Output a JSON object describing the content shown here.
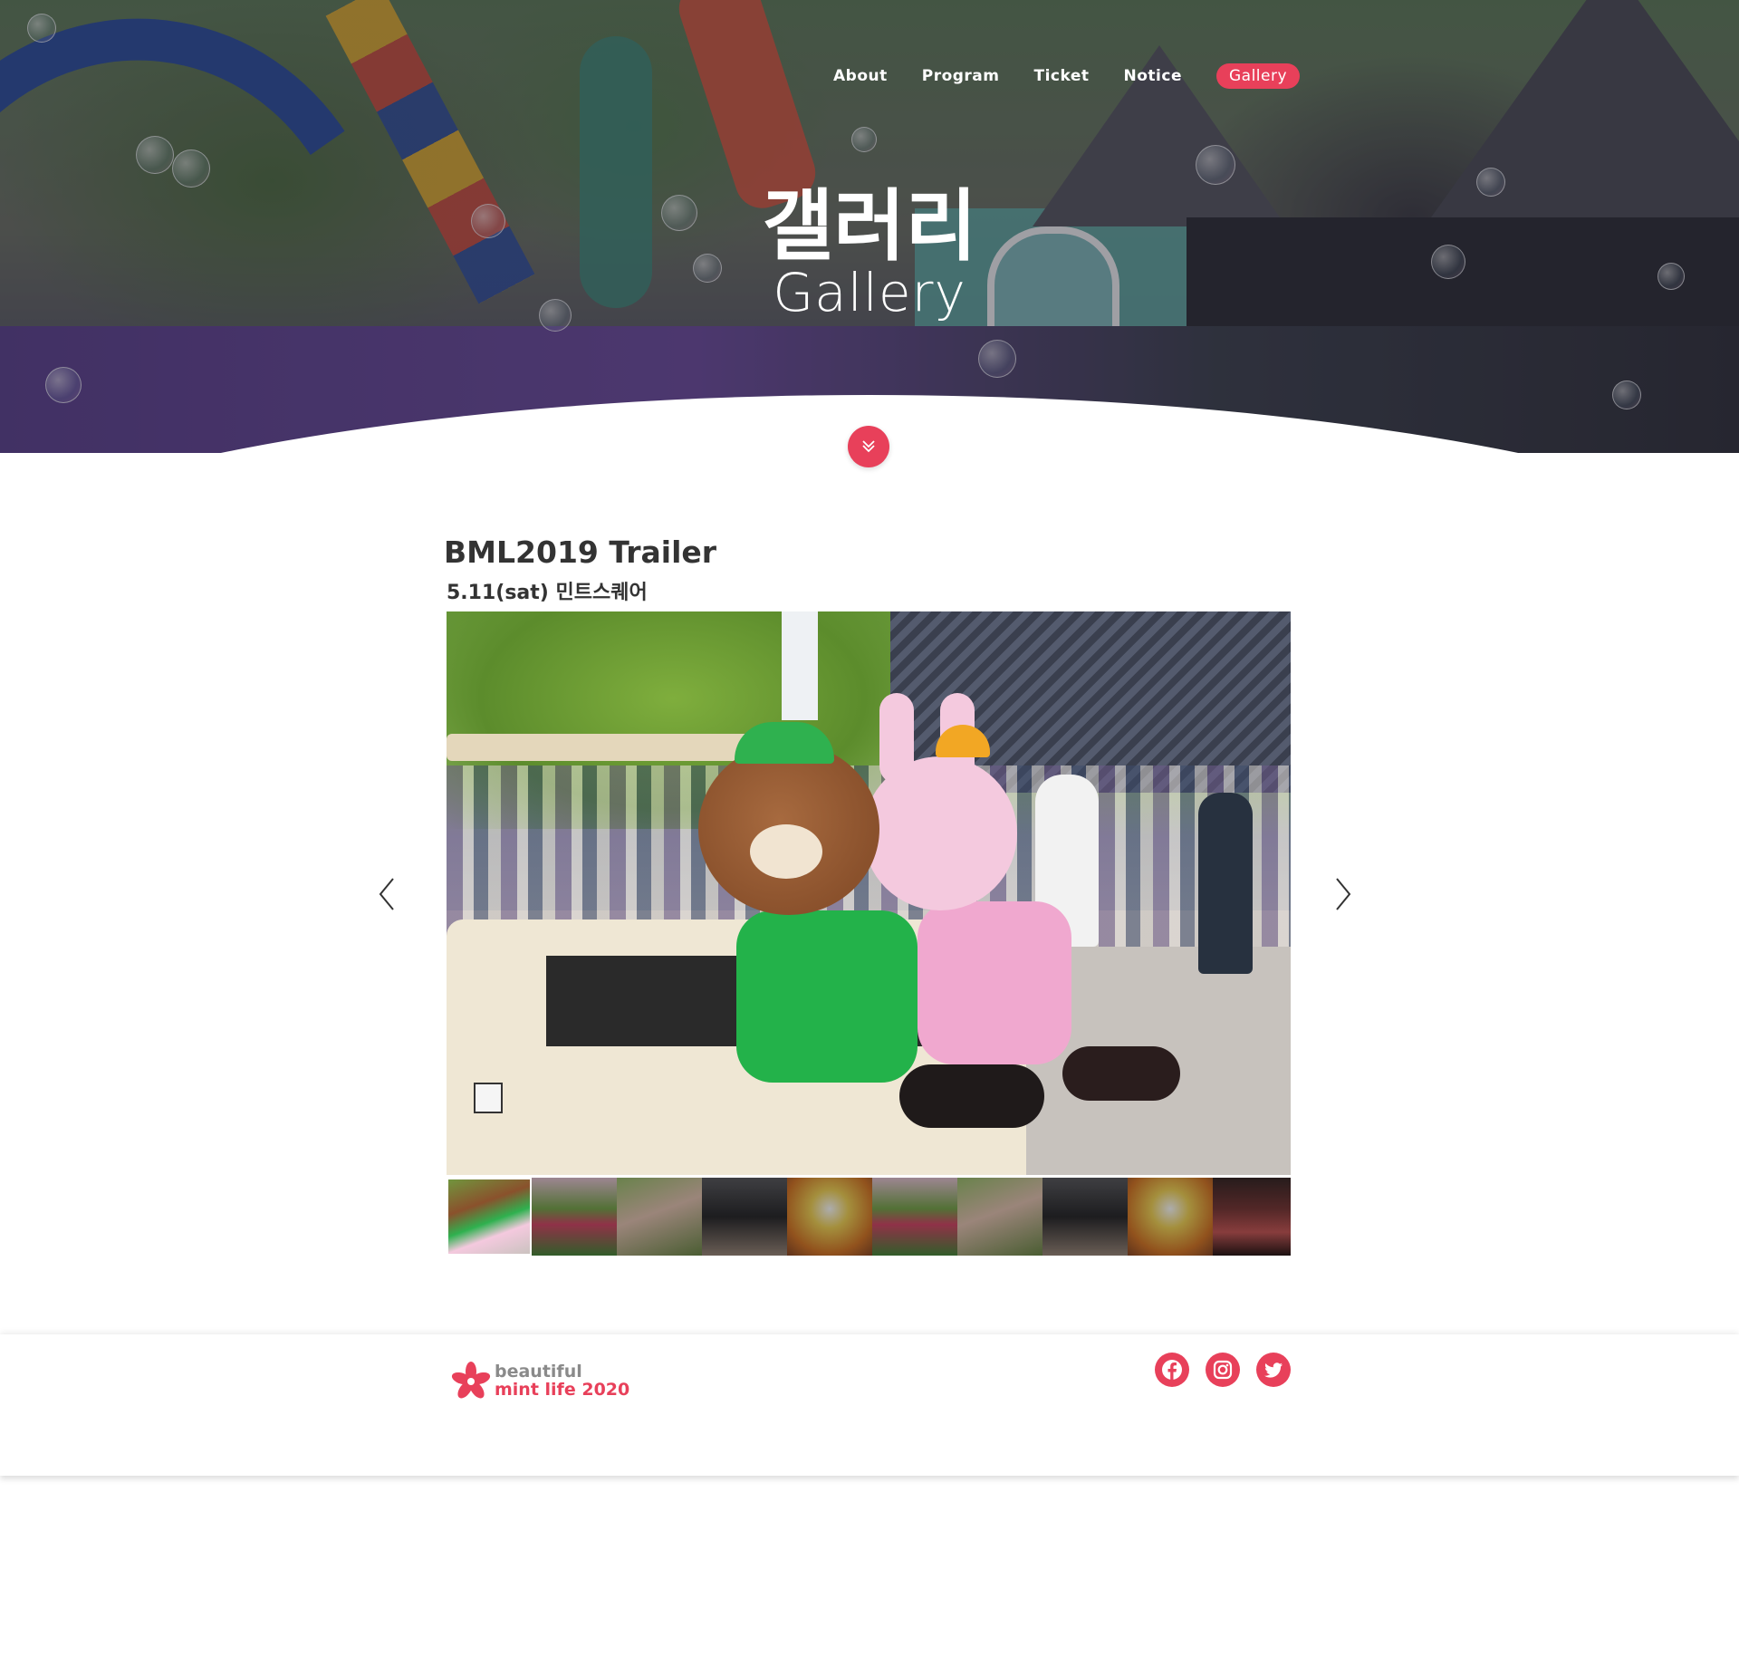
{
  "nav": {
    "items": [
      "About",
      "Program",
      "Ticket",
      "Notice"
    ],
    "active": "Gallery"
  },
  "hero": {
    "title": "갤러리",
    "subtitle": "Gallery"
  },
  "gallery": {
    "title": "BML2019 Trailer",
    "subtitle": "5.11(sat) 민트스퀘어",
    "current_index": 1,
    "thumbnail_count": 10
  },
  "footer": {
    "logo_line1": "beautiful",
    "logo_line2": "mint life",
    "logo_year": "2020",
    "social": [
      "facebook-icon",
      "instagram-icon",
      "twitter-icon"
    ]
  },
  "colors": {
    "accent": "#e8405a",
    "text": "#333333",
    "white": "#ffffff"
  }
}
